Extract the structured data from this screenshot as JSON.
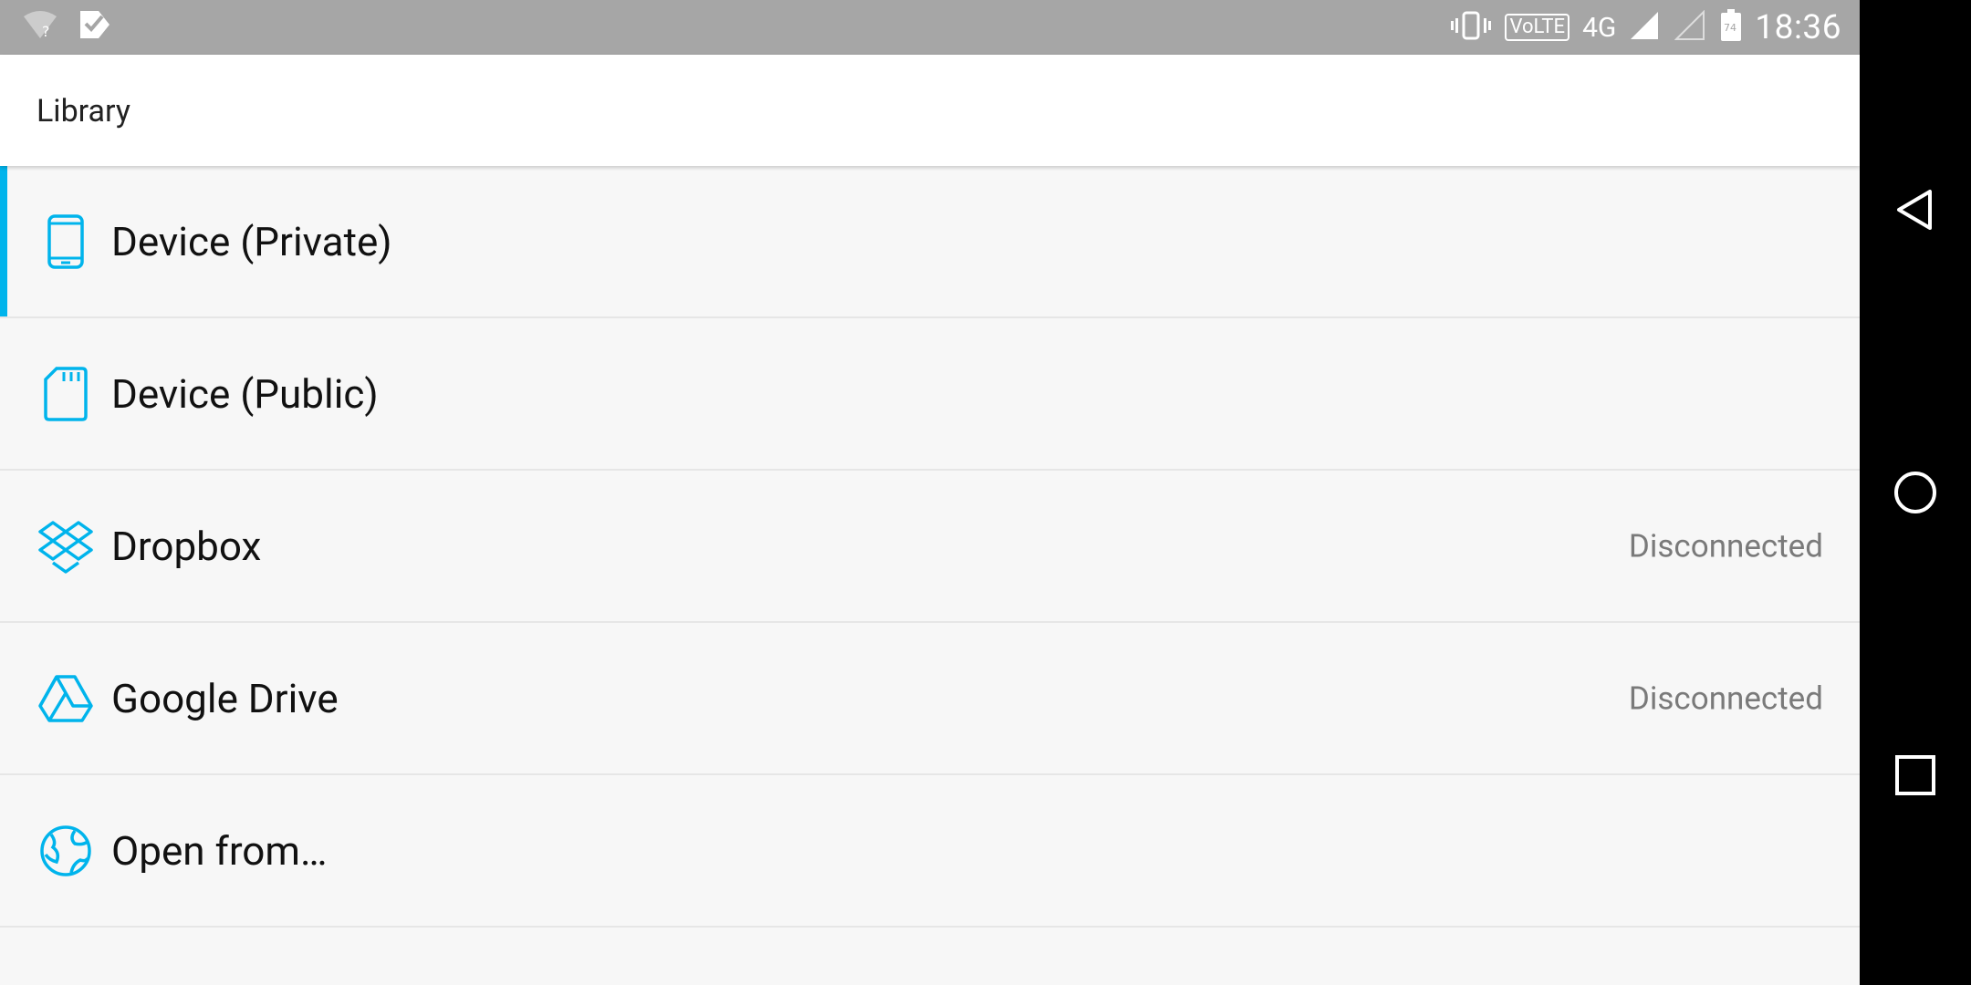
{
  "status_bar": {
    "time": "18:36",
    "network": "4G",
    "network_sup": "4G",
    "volte": "VoLTE",
    "battery": "74"
  },
  "app_bar": {
    "title": "Library"
  },
  "list": {
    "items": [
      {
        "label": "Device (Private)",
        "status": "",
        "icon": "phone-icon",
        "selected": true
      },
      {
        "label": "Device (Public)",
        "status": "",
        "icon": "sd-card-icon"
      },
      {
        "label": "Dropbox",
        "status": "Disconnected",
        "icon": "dropbox-icon"
      },
      {
        "label": "Google Drive",
        "status": "Disconnected",
        "icon": "google-drive-icon"
      },
      {
        "label": "Open from…",
        "status": "",
        "icon": "globe-icon"
      }
    ]
  },
  "colors": {
    "accent": "#00b4ec",
    "status_bar": "#a6a6a6"
  }
}
